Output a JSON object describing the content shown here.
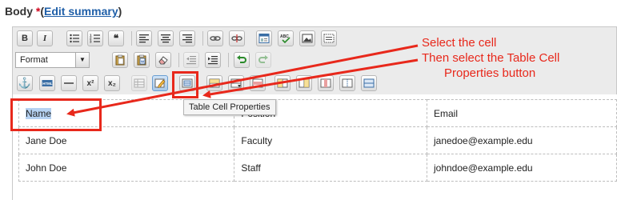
{
  "header": {
    "label": "Body ",
    "required_marker": "*",
    "open_paren": "(",
    "edit_link": "Edit summary",
    "close_paren": ")"
  },
  "toolbar": {
    "row1": [
      "bold-button",
      "italic-button",
      "bulleted-list-button",
      "numbered-list-button",
      "blockquote-button",
      "align-left-button",
      "align-center-button",
      "align-right-button",
      "link-button",
      "unlink-button",
      "template-button",
      "spellcheck-button",
      "image-button",
      "show-blocks-button"
    ],
    "bold_label": "B",
    "italic_label": "I",
    "blockquote_label": "66",
    "format_select": {
      "value": "Format"
    },
    "superscript_label": "x²",
    "subscript_label": "x₂",
    "html_label": "HTML"
  },
  "tooltip": {
    "text": "Table Cell Properties"
  },
  "table": {
    "rows": [
      [
        "Name",
        "Position",
        "Email"
      ],
      [
        "Jane Doe",
        "Faculty",
        "janedoe@example.edu"
      ],
      [
        "John Doe",
        "Staff",
        "johndoe@example.edu"
      ]
    ]
  },
  "annotation": {
    "line1": "Select the cell",
    "line2": "Then select the Table Cell",
    "line3": "Properties button",
    "color": "#e8281b"
  },
  "colors": {
    "link": "#1f5fa8",
    "required": "#d0021b",
    "selection": "#b6d2f2",
    "toolbar_bg": "#ebebeb"
  }
}
